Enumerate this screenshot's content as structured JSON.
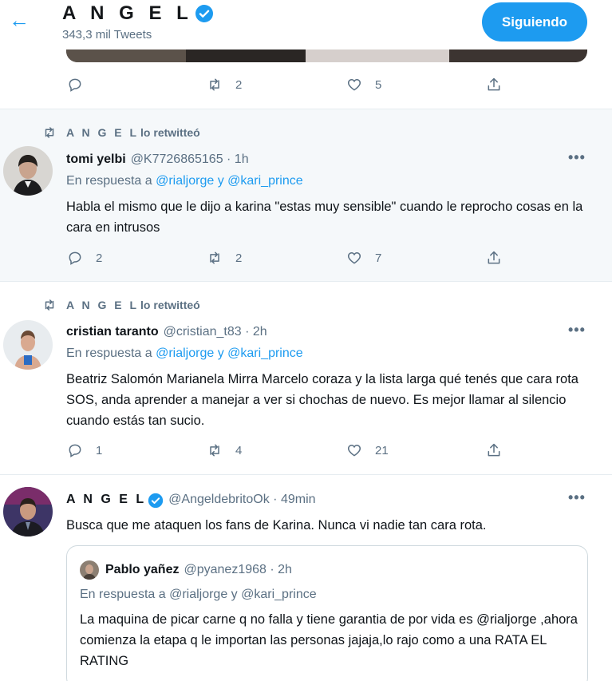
{
  "header": {
    "back_icon": "arrow-left-icon",
    "title": "A N G E L",
    "subtitle": "343,3 mil Tweets",
    "follow_label": "Siguiendo",
    "accent": "#1d9bf0"
  },
  "first_tweet_actions": {
    "reply": "",
    "retweet": "2",
    "like": "5",
    "share": ""
  },
  "tweets": [
    {
      "retweeted_by": "A N G E L",
      "retweet_suffix": "lo retwitteó",
      "name": "tomi yelbi",
      "meta": "@K7726865165 · 1h",
      "reply_prefix": "En respuesta a",
      "reply_user1": "@rialjorge",
      "reply_and": "y",
      "reply_user2": "@kari_prince",
      "text": "Habla el mismo que le dijo a karina \"estas muy sensible\" cuando le reprocho cosas en la cara en intrusos",
      "replies": "2",
      "retweets": "2",
      "likes": "7"
    },
    {
      "retweeted_by": "A N G E L",
      "retweet_suffix": "lo retwitteó",
      "name": "cristian taranto",
      "meta": "@cristian_t83 · 2h",
      "reply_prefix": "En respuesta a",
      "reply_user1": "@rialjorge",
      "reply_and": "y",
      "reply_user2": "@kari_prince",
      "text": "Beatriz Salomón Marianela Mirra Marcelo coraza y la lista larga qué tenés que cara rota SOS, anda aprender a manejar a ver si chochas de nuevo. Es mejor llamar al silencio cuando estás tan sucio.",
      "replies": "1",
      "retweets": "4",
      "likes": "21"
    },
    {
      "name": "A N G E L",
      "meta": "@AngeldebritoOk · 49min",
      "text": "Busca que me ataquen los fans de Karina. Nunca vi nadie tan cara rota.",
      "quote": {
        "name": "Pablo yañez",
        "meta": "@pyanez1968 · 2h",
        "reply": "En respuesta a @rialjorge y @kari_prince",
        "text": "La maquina de picar carne  q no falla y tiene garantia de por vida es @rialjorge ,ahora comienza la etapa q le importan las personas jajaja,lo rajo como a una RATA EL RATING"
      }
    }
  ]
}
